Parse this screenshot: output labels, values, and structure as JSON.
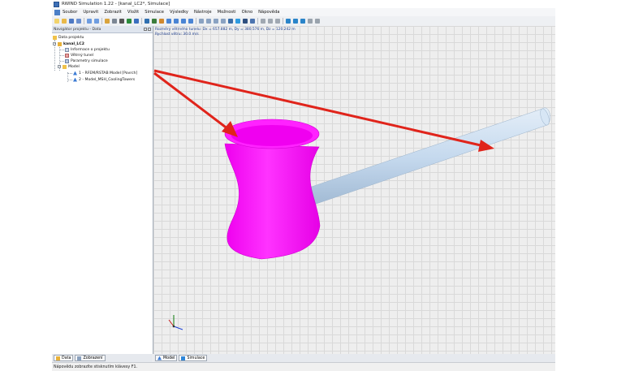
{
  "window": {
    "title": "RWIND Simulation 1.22 - [kanal_LC2*, Simulace]"
  },
  "menu": [
    "Soubor",
    "Upravit",
    "Zobrazit",
    "Vložit",
    "Simulace",
    "Výsledky",
    "Nástroje",
    "Možnosti",
    "Okno",
    "Nápověda"
  ],
  "navigator": {
    "title": "Navigátor projektu - Data",
    "root": "Data projektu",
    "project": "kanal_LC2",
    "items": [
      "Informace o projektu",
      "Větrný tunel",
      "Parametry simulace"
    ],
    "model_folder": "Model",
    "models": [
      "1 - RFEM/RSTAB Model [Povrch]",
      "2 - Model_MSH_CoolingTowers"
    ]
  },
  "viewport": {
    "info_line1": "Rozměry větrného tunelu: Dx = 657.882 m, Dy = 380.576 m, Dz = 120.242 m",
    "info_line2": "Rychlost větru: 30.0 m/s"
  },
  "colors": {
    "tower": "#ff00ff",
    "pipe": "#c8dcef",
    "arrow": "#e0241b"
  },
  "nav_tabs": [
    "Data",
    "Zobrazení"
  ],
  "view_tabs": [
    "Model",
    "Simulace"
  ],
  "status": "Nápovědu zobrazíte stisknutím klávesy F1."
}
